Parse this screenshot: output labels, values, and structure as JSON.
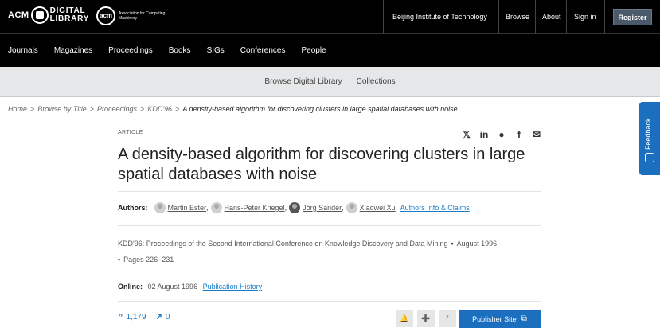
{
  "header": {
    "dl_logo": {
      "acm": "ACM",
      "digital": "DIGITAL",
      "library": "LIBRARY"
    },
    "acm_logo": {
      "mark": "acm",
      "text": "Association for Computing Machinery"
    },
    "institution": "Beijing Institute of Technology",
    "browse": "Browse",
    "about": "About",
    "sign_in": "Sign in",
    "register": "Register"
  },
  "main_nav": [
    "Journals",
    "Magazines",
    "Proceedings",
    "Books",
    "SIGs",
    "Conferences",
    "People"
  ],
  "sub_nav": [
    "Browse Digital Library",
    "Collections"
  ],
  "breadcrumb": {
    "items": [
      "Home",
      "Browse by Title",
      "Proceedings",
      "KDD'96"
    ],
    "current": "A density-based algorithm for discovering clusters in large spatial databases with noise",
    "separator": ">"
  },
  "article": {
    "type": "ARTICLE",
    "title": "A density-based algorithm for discovering clusters in large spatial databases with noise",
    "authors_label": "Authors:",
    "authors": [
      "Martin Ester",
      "Hans-Peter Kriegel",
      "Jörg Sander",
      "Xiaowei Xu"
    ],
    "author_sep": ",",
    "claims_link": "Authors Info & Claims",
    "proceedings": "KDD'96: Proceedings of the Second International Conference on Knowledge Discovery and Data Mining",
    "date": "August 1996",
    "pages": "Pages 226–231",
    "online_label": "Online:",
    "online_date": "02 August 1996",
    "history_link": "Publication History",
    "citations": "1,179",
    "downloads": "0",
    "publisher_site": "Publisher Site"
  },
  "share_icons": [
    "twitter-icon",
    "linkedin-icon",
    "reddit-icon",
    "facebook-icon",
    "email-icon"
  ],
  "feedback": "Feedback",
  "colors": {
    "accent": "#1b6fbe",
    "topbar": "#000000",
    "subnav": "#e6e7e8"
  }
}
